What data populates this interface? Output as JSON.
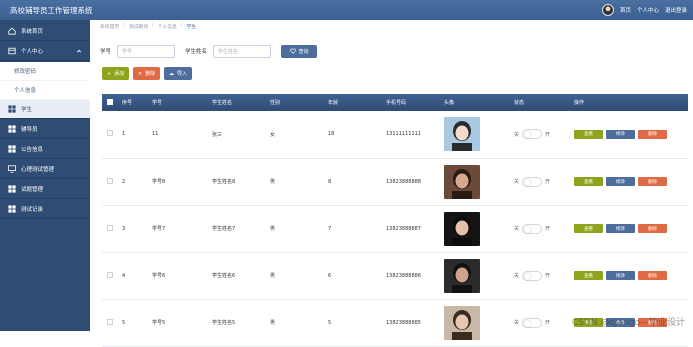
{
  "app": {
    "title": "高校辅导员工作管理系统"
  },
  "header": {
    "home": "首页",
    "profile": "个人中心",
    "logout": "退出登录"
  },
  "sidebar": {
    "items": [
      {
        "label": "系统首页",
        "icon": "home-icon"
      },
      {
        "label": "个人中心",
        "icon": "person-icon"
      },
      {
        "label": "修改密码",
        "icon": ""
      },
      {
        "label": "个人信息",
        "icon": ""
      },
      {
        "label": "学生",
        "icon": "grid-icon"
      },
      {
        "label": "辅导员",
        "icon": "grid-icon"
      },
      {
        "label": "公告信息",
        "icon": "grid-icon"
      },
      {
        "label": "心理测试管理",
        "icon": "monitor-icon"
      },
      {
        "label": "试题管理",
        "icon": "grid-icon"
      },
      {
        "label": "测试记录",
        "icon": "grid-icon"
      }
    ]
  },
  "breadcrumb": [
    "系统首页",
    "测试模块",
    "个人信息",
    "学生"
  ],
  "search": {
    "student_no_label": "学号",
    "student_no_placeholder": "学号",
    "student_name_label": "学生姓名",
    "student_name_placeholder": "学生姓名",
    "search_button": "查询"
  },
  "actions": {
    "add": "添加",
    "delete": "删除",
    "import": "导入"
  },
  "table": {
    "columns": [
      "",
      "序号",
      "学号",
      "学生姓名",
      "性别",
      "年龄",
      "手机号码",
      "头像",
      "状态",
      "操作"
    ],
    "toggle_off": "关",
    "toggle_on": "开",
    "op_view": "查看",
    "op_edit": "修改",
    "op_delete": "删除",
    "rows": [
      {
        "index": "1",
        "student_no": "11",
        "name": "张三",
        "gender": "女",
        "age": "18",
        "phone": "13111111111"
      },
      {
        "index": "2",
        "student_no": "学号8",
        "name": "学生姓名8",
        "gender": "男",
        "age": "8",
        "phone": "13823888888"
      },
      {
        "index": "3",
        "student_no": "学号7",
        "name": "学生姓名7",
        "gender": "男",
        "age": "7",
        "phone": "13823888887"
      },
      {
        "index": "4",
        "student_no": "学号6",
        "name": "学生姓名6",
        "gender": "男",
        "age": "6",
        "phone": "13823888886"
      },
      {
        "index": "5",
        "student_no": "学号5",
        "name": "学生姓名5",
        "gender": "男",
        "age": "5",
        "phone": "13823888885"
      }
    ]
  },
  "watermark": "CSDN @django—毕业设计"
}
